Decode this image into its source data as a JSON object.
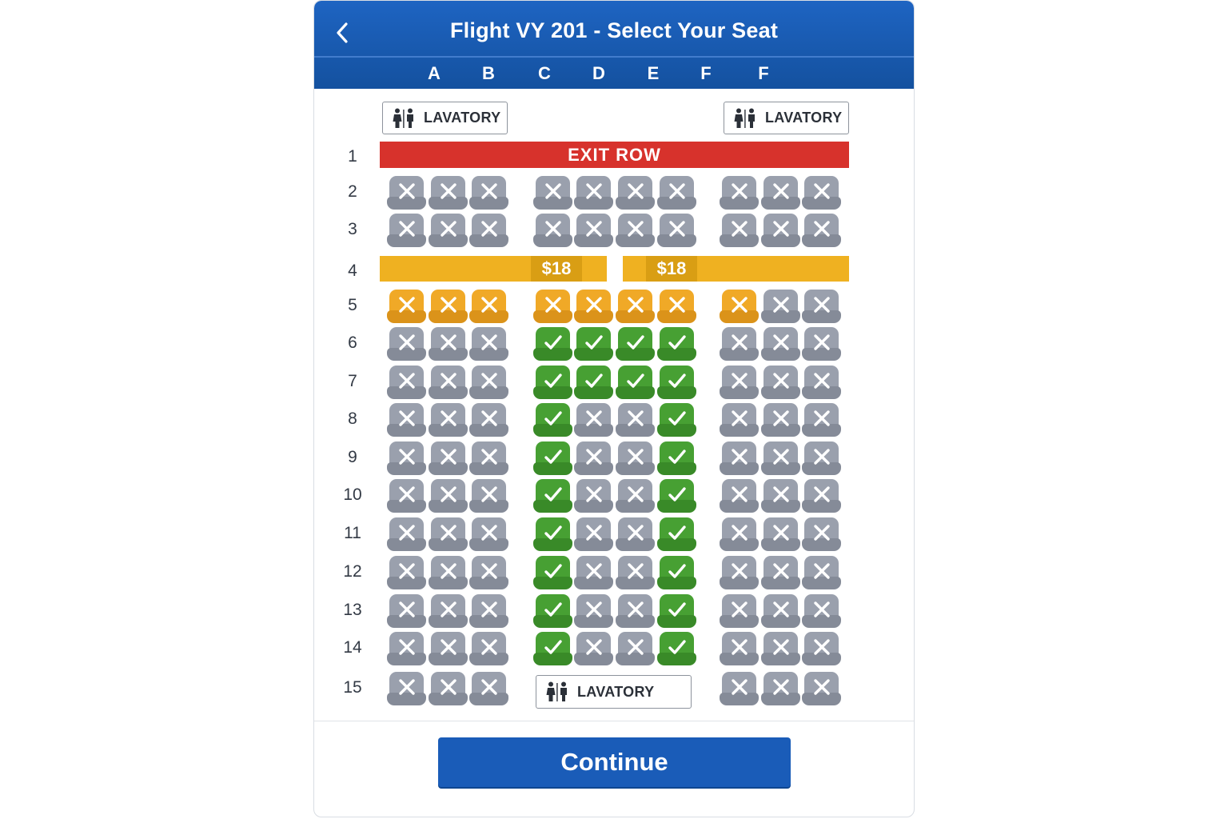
{
  "header": {
    "title": "Flight VY 201 - Select Your Seat",
    "back_icon": "chevron-left-icon"
  },
  "columns": [
    "A",
    "B",
    "C",
    "D",
    "E",
    "F",
    "F"
  ],
  "lavatories": {
    "front_left": "LAVATORY",
    "front_right": "LAVATORY",
    "rear_center": "LAVATORY"
  },
  "exit_row": {
    "row": "1",
    "label": "EXIT ROW"
  },
  "price_row": {
    "row": "4",
    "prices": [
      "$18",
      "$18"
    ]
  },
  "seat_rows": [
    {
      "row": "2",
      "seats": [
        "occupied",
        "occupied",
        "occupied",
        "occupied",
        "occupied",
        "occupied",
        "occupied",
        "occupied",
        "occupied",
        "occupied"
      ]
    },
    {
      "row": "3",
      "seats": [
        "occupied",
        "occupied",
        "occupied",
        "occupied",
        "occupied",
        "occupied",
        "occupied",
        "occupied",
        "occupied",
        "occupied"
      ]
    },
    {
      "row": "5",
      "seats": [
        "premium",
        "premium",
        "premium",
        "premium",
        "premium",
        "premium",
        "premium",
        "premium",
        "occupied",
        "occupied"
      ]
    },
    {
      "row": "6",
      "seats": [
        "occupied",
        "occupied",
        "occupied",
        "available",
        "available",
        "available",
        "available",
        "occupied",
        "occupied",
        "occupied"
      ]
    },
    {
      "row": "7",
      "seats": [
        "occupied",
        "occupied",
        "occupied",
        "available",
        "available",
        "available",
        "available",
        "occupied",
        "occupied",
        "occupied"
      ]
    },
    {
      "row": "8",
      "seats": [
        "occupied",
        "occupied",
        "occupied",
        "available",
        "occupied",
        "occupied",
        "available",
        "occupied",
        "occupied",
        "occupied"
      ]
    },
    {
      "row": "9",
      "seats": [
        "occupied",
        "occupied",
        "occupied",
        "available",
        "occupied",
        "occupied",
        "available",
        "occupied",
        "occupied",
        "occupied"
      ]
    },
    {
      "row": "10",
      "seats": [
        "occupied",
        "occupied",
        "occupied",
        "available",
        "occupied",
        "occupied",
        "available",
        "occupied",
        "occupied",
        "occupied"
      ]
    },
    {
      "row": "11",
      "seats": [
        "occupied",
        "occupied",
        "occupied",
        "available",
        "occupied",
        "occupied",
        "available",
        "occupied",
        "occupied",
        "occupied"
      ]
    },
    {
      "row": "12",
      "seats": [
        "occupied",
        "occupied",
        "occupied",
        "available",
        "occupied",
        "occupied",
        "available",
        "occupied",
        "occupied",
        "occupied"
      ]
    },
    {
      "row": "13",
      "seats": [
        "occupied",
        "occupied",
        "occupied",
        "available",
        "occupied",
        "occupied",
        "available",
        "occupied",
        "occupied",
        "occupied"
      ]
    },
    {
      "row": "14",
      "seats": [
        "occupied",
        "occupied",
        "occupied",
        "available",
        "occupied",
        "occupied",
        "available",
        "occupied",
        "occupied",
        "occupied"
      ]
    },
    {
      "row": "15",
      "seats": [
        "occupied",
        "occupied",
        "occupied",
        null,
        null,
        null,
        null,
        "occupied",
        "occupied",
        "occupied"
      ]
    }
  ],
  "footer": {
    "continue_label": "Continue"
  },
  "colors": {
    "brand_blue": "#1a5cb8",
    "exit_red": "#d7322c",
    "price_yellow": "#efb121",
    "premium_orange": "#f0a927",
    "available_green": "#47a033",
    "occupied_gray": "#9aa0ad"
  }
}
